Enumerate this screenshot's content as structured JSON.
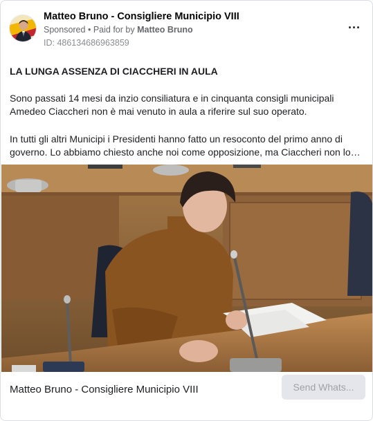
{
  "advertiser": {
    "name": "Matteo Bruno - Consigliere Municipio VIII",
    "sponsored_label": "Sponsored",
    "separator": "•",
    "paid_for_prefix": "Paid for by",
    "paid_for_name": "Matteo Bruno",
    "ad_id": "ID: 486134686963859",
    "more_label": "···"
  },
  "post": {
    "headline": "LA LUNGA ASSENZA DI CIACCHERI IN AULA",
    "paragraph_1": "Sono passati 14 mesi da inzio consiliatura e in cinquanta consigli municipali Amedeo Ciaccheri non è mai venuto in aula a riferire sul suo operato.",
    "paragraph_2": "In tutti gli altri Municipi i Presidenti hanno fatto un resoconto del primo anno di governo. Lo abbiamo chiesto anche noi come opposizione, ma Ciaccheri non lo…"
  },
  "footer": {
    "title": "Matteo Bruno - Consigliere Municipio VIII",
    "cta_label": "Send Whats..."
  },
  "colors": {
    "cta_bg": "#e4e6eb",
    "cta_text": "#9ea2a8",
    "secondary_text": "#65676b"
  }
}
